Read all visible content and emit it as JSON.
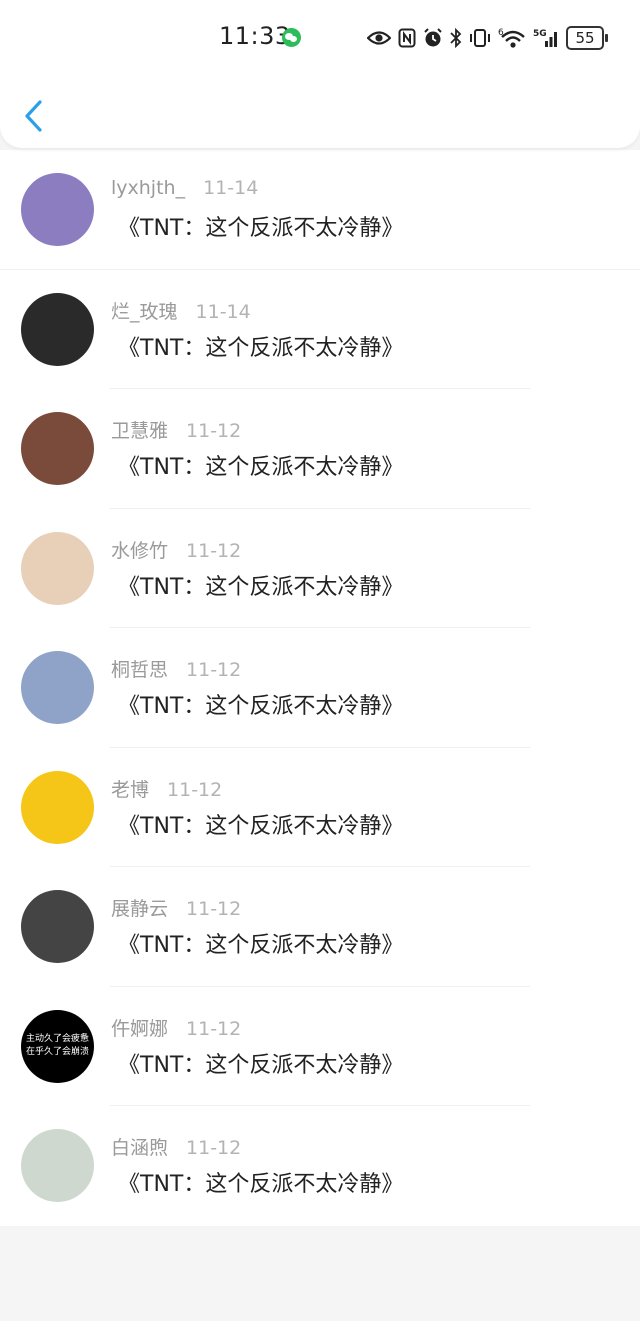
{
  "status_bar": {
    "time": "11:33",
    "battery": "55",
    "icons": [
      "wechat-icon",
      "eye-icon",
      "nfc-icon",
      "alarm-icon",
      "bluetooth-icon",
      "vibrate-icon",
      "wifi-icon",
      "5g-signal-icon",
      "battery-icon"
    ],
    "signal_label": "5G",
    "wifi_label": "6"
  },
  "header": {
    "back_icon": "chevron-left-icon",
    "accent": "#2b9fe8"
  },
  "items": [
    {
      "name": "lyxhjth_",
      "date": "11-14",
      "title": "《TNT：这个反派不太冷静》",
      "avatar_color": "#8c7cc0"
    },
    {
      "name": "烂_玫瑰",
      "date": "11-14",
      "title": "《TNT：这个反派不太冷静》",
      "avatar_color": "#2a2a2a"
    },
    {
      "name": "卫慧雅",
      "date": "11-12",
      "title": "《TNT：这个反派不太冷静》",
      "avatar_color": "#7a4a3a"
    },
    {
      "name": "水修竹",
      "date": "11-12",
      "title": "《TNT：这个反派不太冷静》",
      "avatar_color": "#e8d0b8"
    },
    {
      "name": "桐哲思",
      "date": "11-12",
      "title": "《TNT：这个反派不太冷静》",
      "avatar_color": "#8fa3c8"
    },
    {
      "name": "老博",
      "date": "11-12",
      "title": "《TNT：这个反派不太冷静》",
      "avatar_color": "#f5c518"
    },
    {
      "name": "展静云",
      "date": "11-12",
      "title": "《TNT：这个反派不太冷静》",
      "avatar_color": "#444444"
    },
    {
      "name": "仵婀娜",
      "date": "11-12",
      "title": "《TNT：这个反派不太冷静》",
      "avatar_color": "#000000",
      "avatar_text": [
        "主动久了会疲惫",
        "在乎久了会崩溃"
      ]
    },
    {
      "name": "白涵煦",
      "date": "11-12",
      "title": "《TNT：这个反派不太冷静》",
      "avatar_color": "#cfd8cf"
    }
  ]
}
